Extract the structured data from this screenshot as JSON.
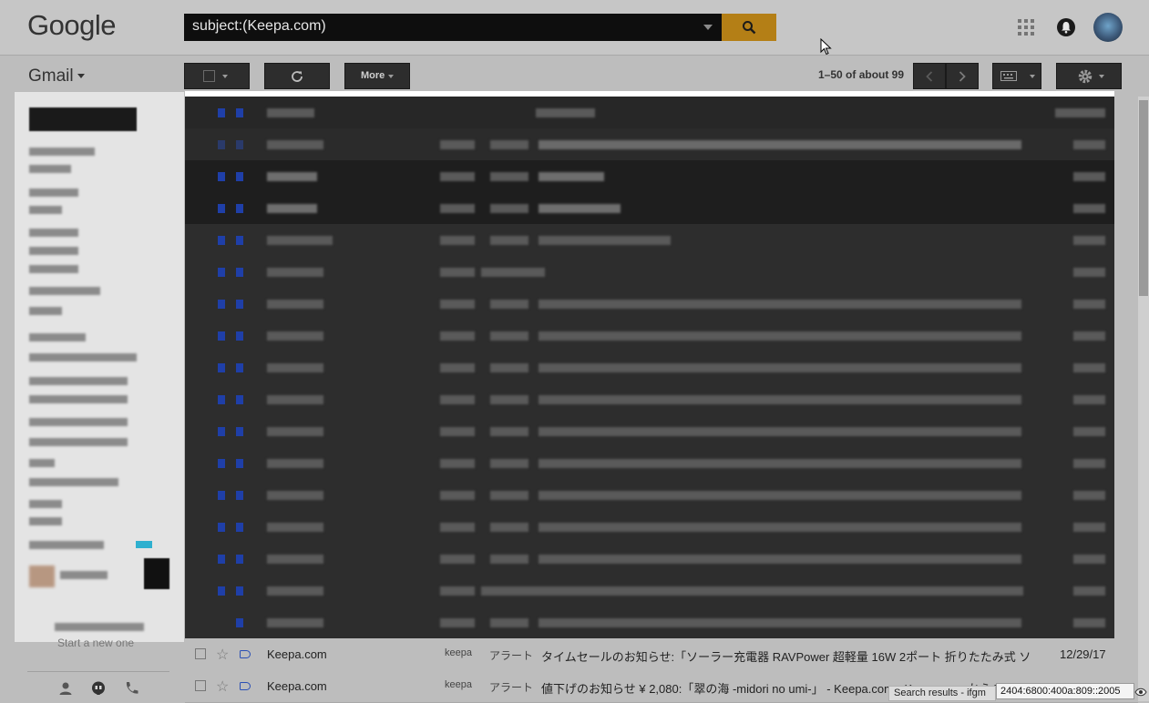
{
  "header": {
    "logo": "Google",
    "search_value": "subject:(Keepa.com)",
    "icons": [
      "apps-icon",
      "notifications-icon",
      "avatar"
    ]
  },
  "toolbar": {
    "app_name": "Gmail",
    "more_label": "More",
    "page_count": "1–50 of about 99"
  },
  "sidebar": {
    "start_new": "Start a new one"
  },
  "messages": [
    {
      "sender": "Keepa.com",
      "label1": "keepa",
      "label2": "アラート",
      "subject": "タイムセールのお知らせ:「ソーラー充電器 RAVPower 超軽量 16W 2ポート 折りたたみ式 ソ",
      "date": "12/29/17"
    },
    {
      "sender": "Keepa.com",
      "label1": "keepa",
      "label2": "アラート",
      "subject": "値下げのお知らせ ¥ 2,080:「翠の海 -midori no umi-」 - Keepa.com - Keepa.com からの",
      "date": ""
    }
  ],
  "statusbar": {
    "link_status": "Search results - ifgm",
    "ip_address": "2404:6800:400a:809::2005"
  },
  "colors": {
    "search_button": "#b47f16",
    "important_marker": "#2a4fb5"
  }
}
